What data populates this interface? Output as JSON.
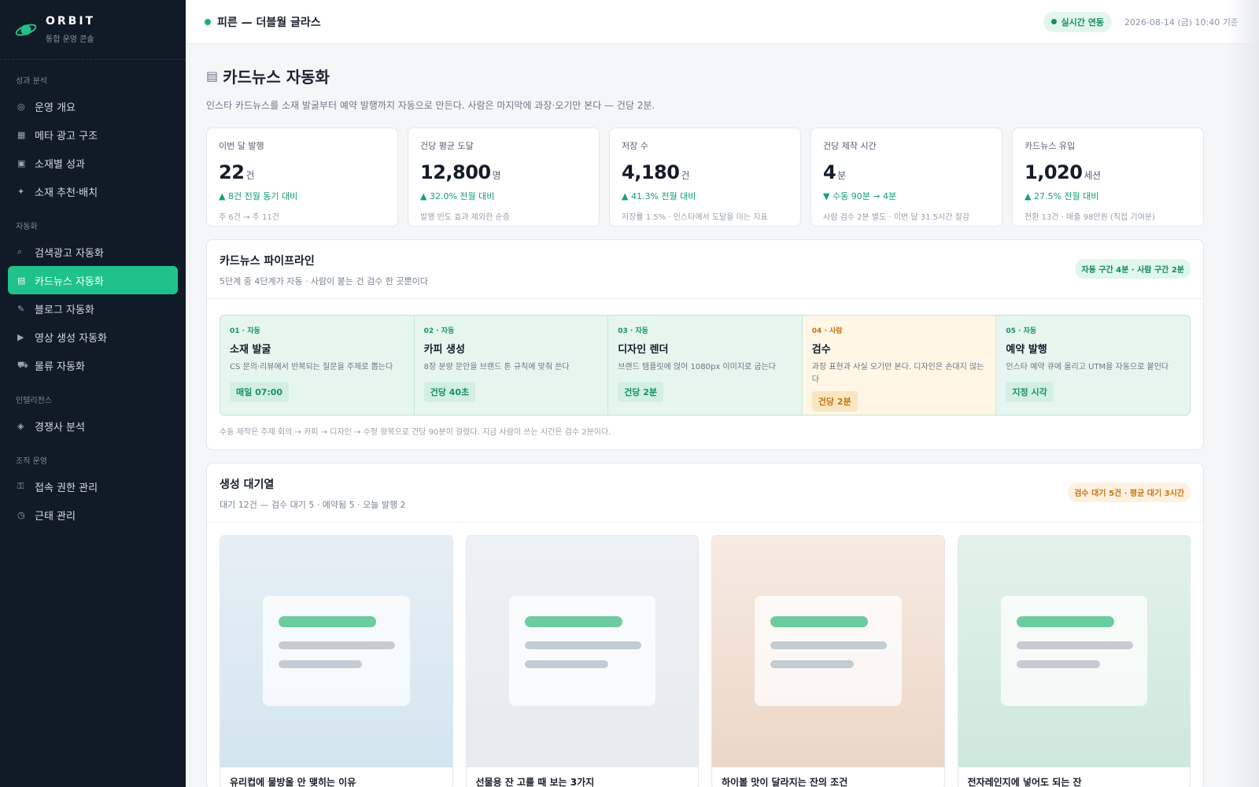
{
  "brand": {
    "name": "ORBIT",
    "subtitle": "통합 운영 콘솔"
  },
  "sidebar": {
    "sections": [
      {
        "title": "성과 분석",
        "items": [
          {
            "icon": "◎",
            "icon_name": "overview-icon",
            "label": "운영 개요"
          },
          {
            "icon": "▦",
            "icon_name": "ad-structure-icon",
            "label": "메타 광고 구조"
          },
          {
            "icon": "▣",
            "icon_name": "creative-icon",
            "label": "소재별 성과"
          },
          {
            "icon": "✦",
            "icon_name": "sparkle-icon",
            "label": "소재 추천·배치"
          }
        ]
      },
      {
        "title": "자동화",
        "items": [
          {
            "icon": "⌕",
            "icon_name": "search-icon",
            "label": "검색광고 자동화"
          },
          {
            "icon": "▤",
            "icon_name": "cardnews-icon",
            "label": "카드뉴스 자동화",
            "active": true
          },
          {
            "icon": "✎",
            "icon_name": "pencil-icon",
            "label": "블로그 자동화"
          },
          {
            "icon": "▶",
            "icon_name": "play-icon",
            "label": "영상 생성 자동화"
          },
          {
            "icon": "⛟",
            "icon_name": "truck-icon",
            "label": "물류 자동화"
          }
        ]
      },
      {
        "title": "인텔리전스",
        "items": [
          {
            "icon": "◈",
            "icon_name": "diamond-icon",
            "label": "경쟁사 분석"
          }
        ]
      },
      {
        "title": "조직 운영",
        "items": [
          {
            "icon": "⚿",
            "icon_name": "key-icon",
            "label": "접속 권한 관리"
          },
          {
            "icon": "◷",
            "icon_name": "clock-icon",
            "label": "근태 관리"
          }
        ]
      }
    ]
  },
  "header": {
    "title": "피른 — 더블월 글라스",
    "live_label": "실시간 연동",
    "timestamp": "2026-08-14 (금) 10:40 기준"
  },
  "page": {
    "icon": "▤",
    "title": "카드뉴스 자동화",
    "description": "인스타 카드뉴스를 소재 발굴부터 예약 발행까지 자동으로 만든다. 사람은 마지막에 과장·오기만 본다 — 건당 2분."
  },
  "kpis": [
    {
      "label": "이번 달 발행",
      "value": "22",
      "unit": "건",
      "delta": "▲ 8건 전월 동기 대비",
      "note": "주 6건 → 주 11건"
    },
    {
      "label": "건당 평균 도달",
      "value": "12,800",
      "unit": "명",
      "delta": "▲ 32.0% 전월 대비",
      "note": "발행 빈도 효과 제외한 순증"
    },
    {
      "label": "저장 수",
      "value": "4,180",
      "unit": "건",
      "delta": "▲ 41.3% 전월 대비",
      "note": "저장률 1.5% · 인스타에서 도달을 미는 지표"
    },
    {
      "label": "건당 제작 시간",
      "value": "4",
      "unit": "분",
      "delta": "▼ 수동 90분 → 4분",
      "note": "사람 검수 2분 별도 · 이번 달 31.5시간 절감"
    },
    {
      "label": "카드뉴스 유입",
      "value": "1,020",
      "unit": "세션",
      "delta": "▲ 27.5% 전월 대비",
      "note": "전환 13건 · 매출 98만원 (직접 기여분)"
    }
  ],
  "pipeline": {
    "title": "카드뉴스 파이프라인",
    "subtitle": "5단계 중 4단계가 자동 · 사람이 붙는 건 검수 한 곳뿐이다",
    "badge": "자동 구간 4분 · 사람 구간 2분",
    "stages": [
      {
        "tag": "01 · 자동",
        "name": "소재 발굴",
        "desc": "CS 문의·리뷰에서 반복되는 질문을 주제로 뽑는다",
        "chip": "매일 07:00",
        "human": false
      },
      {
        "tag": "02 · 자동",
        "name": "카피 생성",
        "desc": "8장 분량 문안을 브랜드 톤 규칙에 맞춰 쓴다",
        "chip": "건당 40초",
        "human": false
      },
      {
        "tag": "03 · 자동",
        "name": "디자인 렌더",
        "desc": "브랜드 템플릿에 얹어 1080px 이미지로 굽는다",
        "chip": "건당 2분",
        "human": false
      },
      {
        "tag": "04 · 사람",
        "name": "검수",
        "desc": "과장 표현과 사실 오기만 본다. 디자인은 손대지 않는다",
        "chip": "건당 2분",
        "human": true
      },
      {
        "tag": "05 · 자동",
        "name": "예약 발행",
        "desc": "인스타 예약 큐에 올리고 UTM을 자동으로 붙인다",
        "chip": "지정 시각",
        "human": false
      }
    ],
    "footnote": "수동 제작은 주제 회의 → 카피 → 디자인 → 수정 왕복으로 건당 90분이 걸렸다. 지금 사람이 쓰는 시간은 검수 2분이다."
  },
  "queue": {
    "title": "생성 대기열",
    "subtitle": "대기 12건 — 검수 대기 5 · 예약됨 5 · 오늘 발행 2",
    "badge": "검수 대기 5건 · 평균 대기 3시간",
    "cards": [
      {
        "title": "유리컵에 물방울 안 맺히는 이유",
        "bg": [
          "#e6eff5",
          "#d4e5ef"
        ]
      },
      {
        "title": "선물용 잔 고를 때 보는 3가지",
        "bg": [
          "#eef1f4",
          "#e6ebef"
        ]
      },
      {
        "title": "하이볼 맛이 달라지는 잔의 조건",
        "bg": [
          "#f6ebe3",
          "#ecd6c6"
        ]
      },
      {
        "title": "전자레인지에 넣어도 되는 잔",
        "bg": [
          "#e3f2ea",
          "#cde9db"
        ]
      }
    ]
  },
  "colors": {
    "accent": "#1fc28a",
    "sidebar_bg": "#111a27",
    "positive": "#15a06b",
    "warning": "#c4740f"
  }
}
